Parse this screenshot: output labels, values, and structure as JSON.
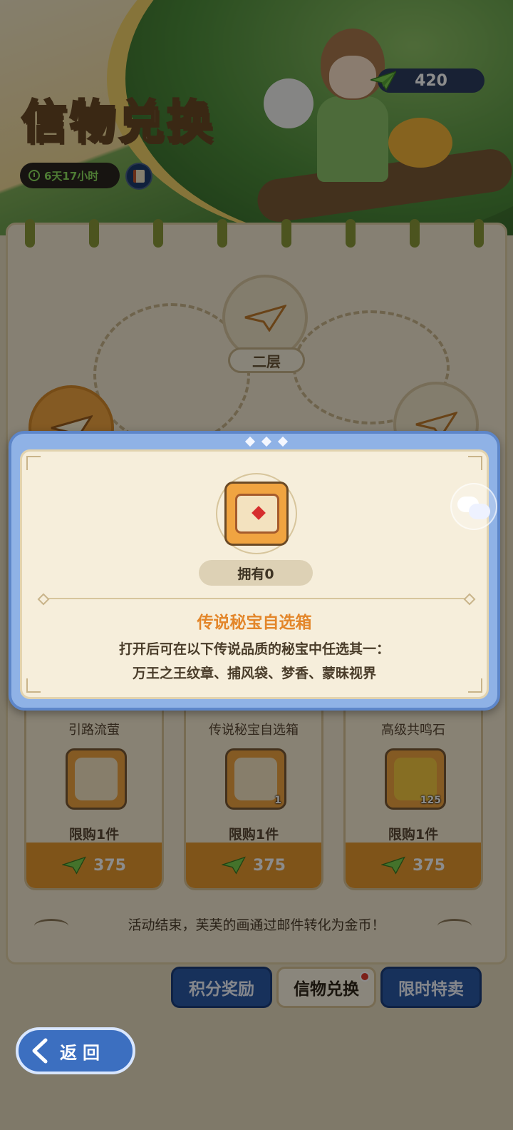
{
  "header": {
    "title": "信物兑换",
    "timer": "6天17小时",
    "currency_amount": "420"
  },
  "board": {
    "floor_label": "二层"
  },
  "shop_items": [
    {
      "name": "引路流萤",
      "qty": "",
      "limit": "限购1件",
      "price": "375"
    },
    {
      "name": "传说秘宝自选箱",
      "qty": "1",
      "limit": "限购1件",
      "price": "375"
    },
    {
      "name": "高级共鸣石",
      "qty": "125",
      "limit": "限购1件",
      "price": "375"
    }
  ],
  "footer_note": "活动结束，芙芙的画通过邮件转化为金币！",
  "tabs": [
    {
      "label": "积分奖励"
    },
    {
      "label": "信物兑换",
      "active": true,
      "has_dot": true
    },
    {
      "label": "限时特卖"
    }
  ],
  "back_button": {
    "label": "返回"
  },
  "popup": {
    "owned": "拥有0",
    "item_name": "传说秘宝自选箱",
    "desc_line1": "打开后可在以下传说品质的秘宝中任选其一：",
    "desc_line2": "万王之王纹章、捕风袋、梦香、蒙昧视界"
  },
  "colors": {
    "popup_frame": "#8fb2e6",
    "popup_inner": "#f6eedb",
    "item_name": "#e3862a",
    "tab_blue": "#2a5aa7",
    "price_bar": "#e89a2f"
  },
  "icons": [
    "clock-icon",
    "book-icon",
    "paper-plane-icon",
    "treasure-chest-icon",
    "chat-icon",
    "back-arrow-icon"
  ]
}
